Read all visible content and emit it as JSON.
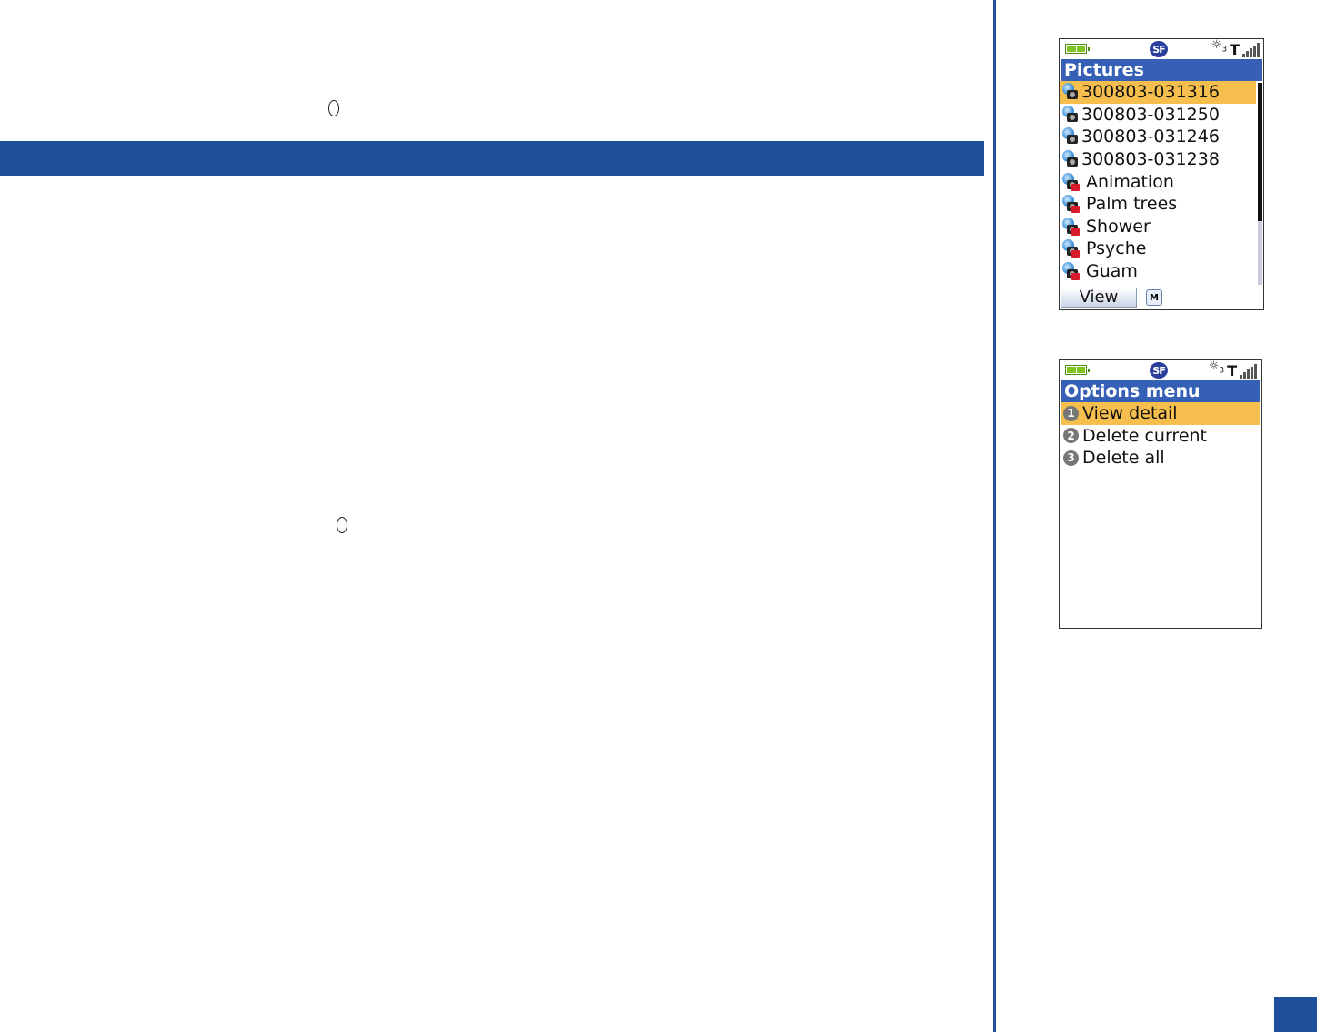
{
  "screen1": {
    "operator": "SF",
    "status_sub": "3",
    "title": "Pictures",
    "items": [
      {
        "label": "300803-031316",
        "type": "camera",
        "selected": true
      },
      {
        "label": "300803-031250",
        "type": "camera",
        "selected": false
      },
      {
        "label": "300803-031246",
        "type": "camera",
        "selected": false
      },
      {
        "label": "300803-031238",
        "type": "camera",
        "selected": false
      },
      {
        "label": "Animation",
        "type": "locked",
        "selected": false
      },
      {
        "label": "Palm trees",
        "type": "locked",
        "selected": false
      },
      {
        "label": "Shower",
        "type": "locked",
        "selected": false
      },
      {
        "label": "Psyche",
        "type": "locked",
        "selected": false
      },
      {
        "label": "Guam",
        "type": "locked",
        "selected": false
      }
    ],
    "softkey_label": "View",
    "menu_key_icon": "M"
  },
  "screen2": {
    "operator": "SF",
    "status_sub": "3",
    "title": "Options menu",
    "items": [
      {
        "number": "1",
        "label": "View detail",
        "selected": true
      },
      {
        "number": "2",
        "label": "Delete current",
        "selected": false
      },
      {
        "number": "3",
        "label": "Delete all",
        "selected": false
      }
    ]
  },
  "colors": {
    "accent_blue": "#1e4f9b",
    "title_bar": "#3560b6",
    "selection": "#f6bf4d"
  }
}
